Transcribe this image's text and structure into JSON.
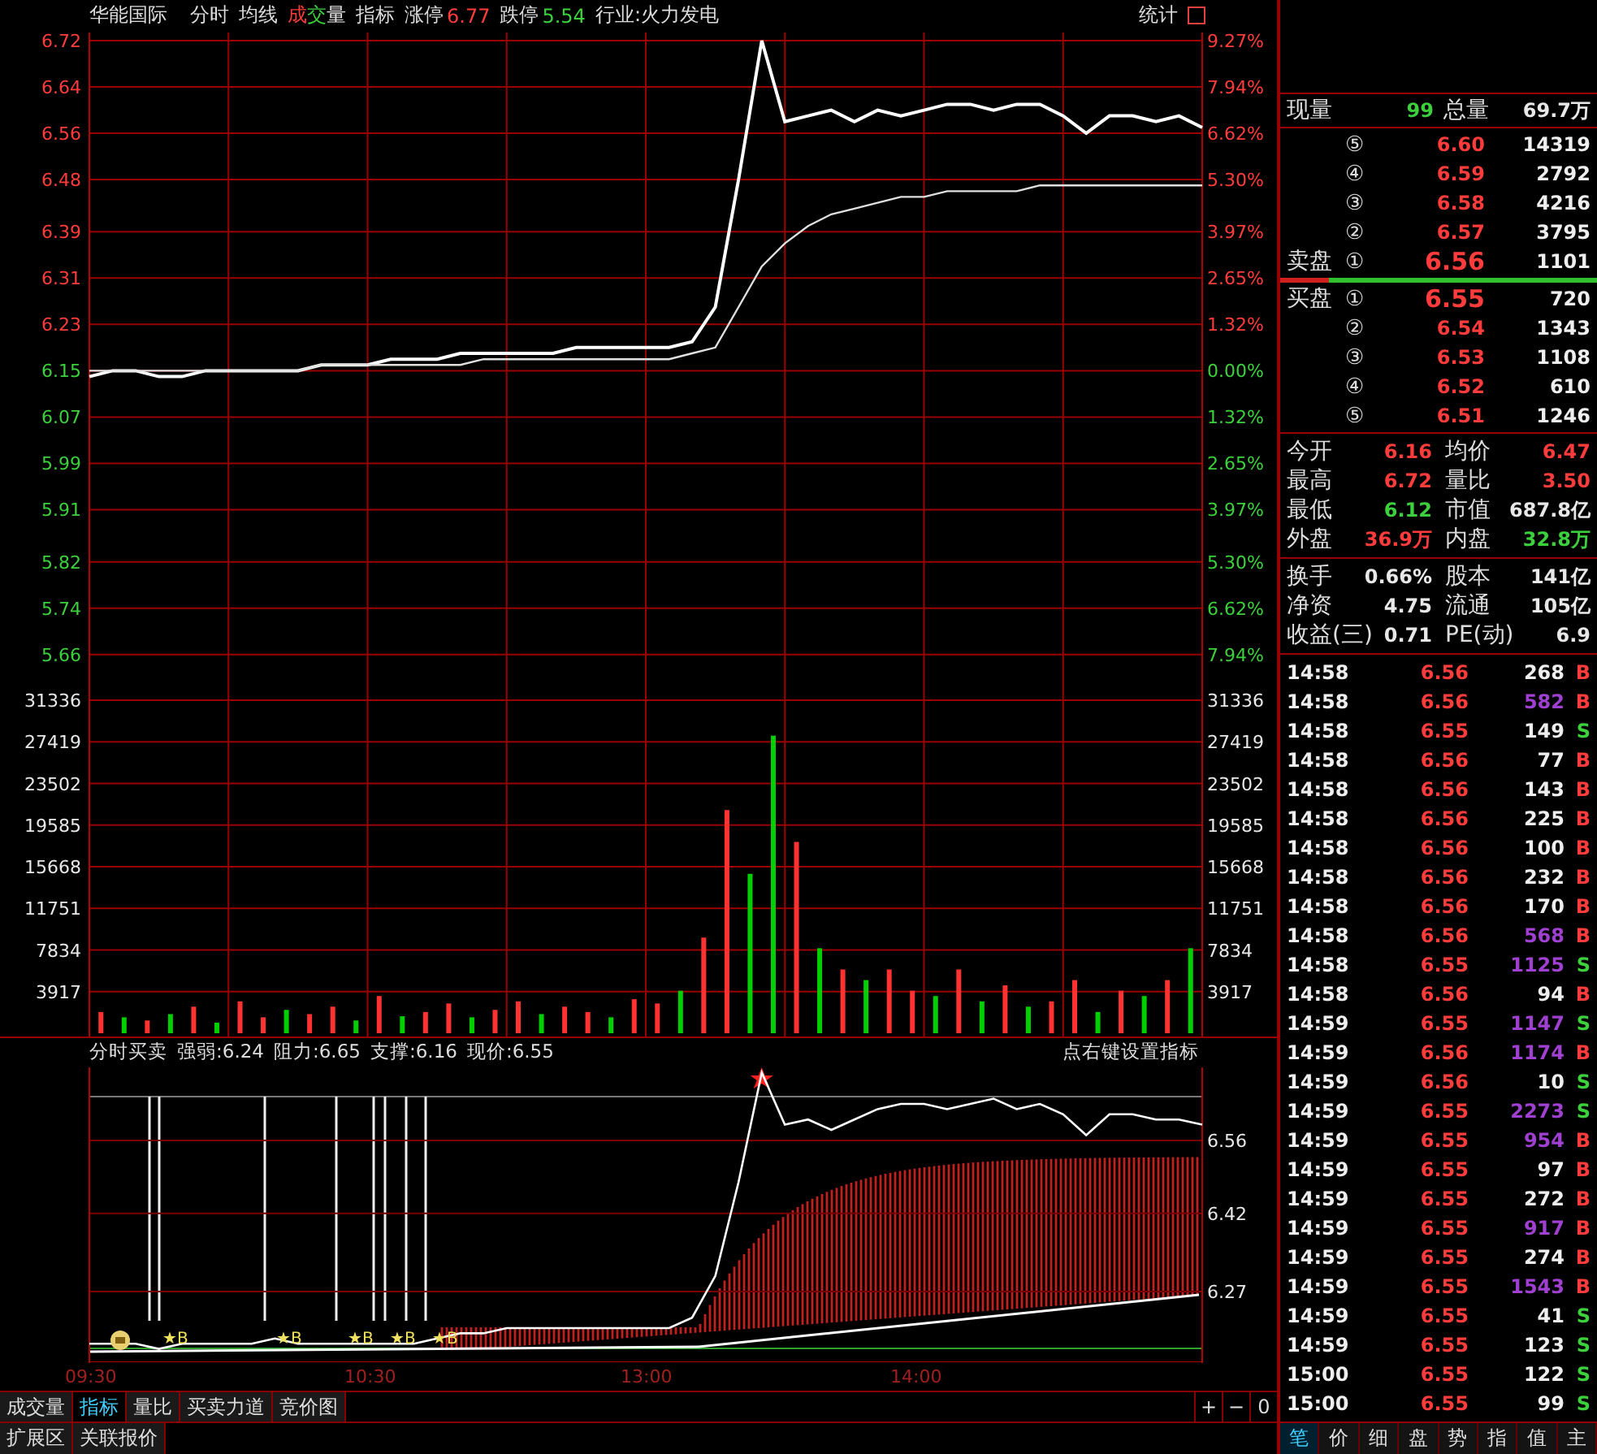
{
  "top_bar": {
    "stock": "华能国际",
    "items": [
      "分时",
      "均线"
    ],
    "volume_legend": "成交量",
    "indicator": "指标",
    "limit_up": {
      "label": "涨停",
      "value": "6.77"
    },
    "limit_down": {
      "label": "跌停",
      "value": "5.54"
    },
    "industry": "行业:火力发电",
    "stats_button": "统计"
  },
  "price_chart": {
    "right_labels": [
      "9.27%",
      "7.94%",
      "6.62%",
      "5.30%",
      "3.97%",
      "2.65%",
      "1.32%",
      "0.00%",
      "1.32%",
      "2.65%",
      "3.97%",
      "5.30%",
      "6.62%",
      "7.94%"
    ],
    "chart_data": {
      "type": "line",
      "grid": true,
      "ylim": [
        5.64,
        6.734
      ],
      "yticks": [
        {
          "value": 6.72,
          "label": "6.72"
        },
        {
          "value": 6.64,
          "label": "6.64"
        },
        {
          "value": 6.56,
          "label": "6.56"
        },
        {
          "value": 6.48,
          "label": "6.48"
        },
        {
          "value": 6.39,
          "label": "6.39"
        },
        {
          "value": 6.31,
          "label": "6.31"
        },
        {
          "value": 6.23,
          "label": "6.23"
        },
        {
          "value": 6.15,
          "label": "6.15"
        },
        {
          "value": 6.07,
          "label": "6.07"
        },
        {
          "value": 5.99,
          "label": "5.99"
        },
        {
          "value": 5.91,
          "label": "5.91"
        },
        {
          "value": 5.82,
          "label": "5.82"
        },
        {
          "value": 5.74,
          "label": "5.74"
        },
        {
          "value": 5.66,
          "label": "5.66"
        }
      ],
      "categories": [
        null,
        null,
        null,
        null,
        null,
        null,
        null,
        null,
        null,
        null,
        null,
        null,
        null,
        null,
        null,
        null,
        null,
        null,
        null,
        null,
        null,
        null,
        null,
        null,
        null,
        null,
        null,
        null,
        null,
        null,
        null,
        null,
        null,
        null,
        null,
        null,
        null,
        null,
        null,
        null,
        null,
        null,
        null,
        null,
        null,
        null,
        null,
        null,
        null
      ],
      "series": [
        {
          "color": "#ffffff",
          "values": [
            6.14,
            6.15,
            6.15,
            6.14,
            6.14,
            6.15,
            6.15,
            6.15,
            6.15,
            6.15,
            6.16,
            6.16,
            6.16,
            6.17,
            6.17,
            6.17,
            6.18,
            6.18,
            6.18,
            6.18,
            6.18,
            6.19,
            6.19,
            6.19,
            6.19,
            6.19,
            6.2,
            6.26,
            6.48,
            6.72,
            6.58,
            6.59,
            6.6,
            6.58,
            6.6,
            6.59,
            6.6,
            6.61,
            6.61,
            6.6,
            6.61,
            6.61,
            6.59,
            6.56,
            6.59,
            6.59,
            6.58,
            6.59,
            6.57
          ]
        },
        {
          "color": "#e0e0e0",
          "values": [
            6.15,
            6.15,
            6.15,
            6.15,
            6.15,
            6.15,
            6.15,
            6.15,
            6.15,
            6.15,
            6.16,
            6.16,
            6.16,
            6.16,
            6.16,
            6.16,
            6.16,
            6.17,
            6.17,
            6.17,
            6.17,
            6.17,
            6.17,
            6.17,
            6.17,
            6.17,
            6.18,
            6.19,
            6.26,
            6.33,
            6.37,
            6.4,
            6.42,
            6.43,
            6.44,
            6.45,
            6.45,
            6.46,
            6.46,
            6.46,
            6.46,
            6.47,
            6.47,
            6.47,
            6.47,
            6.47,
            6.47,
            6.47,
            6.47
          ]
        }
      ]
    }
  },
  "volume_chart": {
    "chart_data": {
      "type": "bar",
      "stacked": true,
      "grid": true,
      "ylim": [
        0,
        31336
      ],
      "yticks": [
        {
          "value": 31336,
          "label": "31336"
        },
        {
          "value": 27419,
          "label": "27419"
        },
        {
          "value": 23502,
          "label": "23502"
        },
        {
          "value": 19585,
          "label": "19585"
        },
        {
          "value": 15668,
          "label": "15668"
        },
        {
          "value": 11751,
          "label": "11751"
        },
        {
          "value": 7834,
          "label": "7834"
        },
        {
          "value": 3917,
          "label": "3917"
        }
      ],
      "categories": [
        null,
        null,
        null,
        null,
        null,
        null,
        null,
        null,
        null,
        null,
        null,
        null,
        null,
        null,
        null,
        null,
        null,
        null,
        null,
        null,
        null,
        null,
        null,
        null,
        null,
        null,
        null,
        null,
        null,
        null,
        null,
        null,
        null,
        null,
        null,
        null,
        null,
        null,
        null,
        null,
        null,
        null,
        null,
        null,
        null,
        null,
        null,
        null
      ],
      "series": [
        {
          "color": "#ff3232",
          "values": [
            2000,
            null,
            1200,
            null,
            2500,
            null,
            3000,
            1500,
            null,
            1800,
            2500,
            null,
            3500,
            null,
            2000,
            2800,
            null,
            2200,
            3000,
            null,
            2500,
            2000,
            null,
            3200,
            2800,
            null,
            9000,
            21000,
            null,
            null,
            18000,
            null,
            6000,
            null,
            6000,
            4000,
            null,
            6000,
            null,
            4500,
            null,
            3000,
            5000,
            null,
            4000,
            null,
            5000,
            null
          ]
        },
        {
          "color": "#00d000",
          "values": [
            null,
            1500,
            null,
            1800,
            null,
            1000,
            null,
            null,
            2200,
            null,
            null,
            1200,
            null,
            1600,
            null,
            null,
            1500,
            null,
            null,
            1800,
            null,
            null,
            1500,
            null,
            null,
            4000,
            null,
            null,
            15000,
            28000,
            null,
            8000,
            null,
            5000,
            null,
            null,
            3500,
            null,
            3000,
            null,
            2500,
            null,
            null,
            2000,
            null,
            3500,
            null,
            8000
          ]
        }
      ]
    }
  },
  "indicator_panel": {
    "title": "分时买卖",
    "readings": [
      "强弱:6.24",
      "阻力:6.65",
      "支撑:6.16",
      "现价:6.55"
    ],
    "hint": "点右键设置指标",
    "signals": [
      {
        "label": "★B"
      },
      {
        "label": "★B"
      },
      {
        "label": "★B"
      },
      {
        "label": "★B"
      },
      {
        "label": "★B"
      }
    ],
    "chart_data": {
      "type": "line",
      "grid": true,
      "ylim": [
        6.133,
        6.7
      ],
      "yticks": [
        {
          "value": 6.56,
          "label": "6.56"
        },
        {
          "value": 6.42,
          "label": "6.42"
        },
        {
          "value": 6.27,
          "label": "6.27"
        }
      ],
      "categories": [
        null,
        null,
        null,
        null,
        null,
        null,
        null,
        null,
        null,
        null,
        null,
        null,
        null,
        null,
        null,
        null,
        null,
        null,
        null,
        null,
        null,
        null,
        null,
        null,
        null,
        null,
        null,
        null,
        null,
        null,
        null,
        null,
        null,
        null,
        null,
        null,
        null,
        null,
        null,
        null,
        null,
        null,
        null,
        null,
        null,
        null,
        null,
        null,
        null
      ],
      "series": [
        {
          "color": "#ffffff",
          "values": [
            6.17,
            6.17,
            6.17,
            6.16,
            6.17,
            6.17,
            6.17,
            6.17,
            6.18,
            6.17,
            6.17,
            6.17,
            6.17,
            6.17,
            6.17,
            6.18,
            6.19,
            6.19,
            6.2,
            6.2,
            6.2,
            6.2,
            6.2,
            6.2,
            6.2,
            6.2,
            6.22,
            6.3,
            6.48,
            6.69,
            6.59,
            6.6,
            6.58,
            6.6,
            6.62,
            6.63,
            6.63,
            6.62,
            6.63,
            6.64,
            6.62,
            6.63,
            6.61,
            6.57,
            6.61,
            6.61,
            6.6,
            6.6,
            6.59
          ]
        }
      ]
    }
  },
  "time_axis": [
    "09:30",
    "10:30",
    "13:00",
    "14:00"
  ],
  "chart_tabs": [
    {
      "label": "成交量",
      "selected": false
    },
    {
      "label": "指标",
      "selected": true
    },
    {
      "label": "量比",
      "selected": false
    },
    {
      "label": "买卖力道",
      "selected": false
    },
    {
      "label": "竞价图",
      "selected": false
    }
  ],
  "zoom_buttons": [
    "+",
    "−",
    "0"
  ],
  "bottom_tabs": [
    {
      "label": "扩展区",
      "selected": false
    },
    {
      "label": "关联报价",
      "selected": false
    }
  ],
  "quote": {
    "current_volume_label": "现量",
    "current_volume": "99",
    "total_volume_label": "总量",
    "total_volume": "69.7万"
  },
  "asks": [
    {
      "level": "⑤",
      "price": "6.60",
      "volume": "14319"
    },
    {
      "level": "④",
      "price": "6.59",
      "volume": "2792"
    },
    {
      "level": "③",
      "price": "6.58",
      "volume": "4216"
    },
    {
      "level": "②",
      "price": "6.57",
      "volume": "3795"
    },
    {
      "label": "卖盘",
      "level": "①",
      "price": "6.56",
      "volume": "1101"
    }
  ],
  "bids": [
    {
      "label": "买盘",
      "level": "①",
      "price": "6.55",
      "volume": "720"
    },
    {
      "level": "②",
      "price": "6.54",
      "volume": "1343"
    },
    {
      "level": "③",
      "price": "6.53",
      "volume": "1108"
    },
    {
      "level": "④",
      "price": "6.52",
      "volume": "610"
    },
    {
      "level": "⑤",
      "price": "6.51",
      "volume": "1246"
    }
  ],
  "stats": [
    {
      "label": "今开",
      "value": "6.16",
      "kind": "up"
    },
    {
      "label": "均价",
      "value": "6.47",
      "kind": "up"
    },
    {
      "label": "最高",
      "value": "6.72",
      "kind": "up"
    },
    {
      "label": "量比",
      "value": "3.50",
      "kind": "up"
    },
    {
      "label": "最低",
      "value": "6.12",
      "kind": "down"
    },
    {
      "label": "市值",
      "value": "687.8亿",
      "kind": "flat"
    },
    {
      "label": "外盘",
      "value": "36.9万",
      "kind": "up"
    },
    {
      "label": "内盘",
      "value": "32.8万",
      "kind": "down"
    }
  ],
  "fundamentals": [
    {
      "label": "换手",
      "value": "0.66%"
    },
    {
      "label": "股本",
      "value": "141亿"
    },
    {
      "label": "净资",
      "value": "4.75"
    },
    {
      "label": "流通",
      "value": "105亿"
    },
    {
      "label": "收益(三)",
      "value": "0.71"
    },
    {
      "label": "PE(动)",
      "value": "6.9"
    }
  ],
  "ticks": [
    {
      "time": "14:58",
      "price": "6.56",
      "volume": "268",
      "large": false,
      "side": "B",
      "kind": "buy"
    },
    {
      "time": "14:58",
      "price": "6.56",
      "volume": "582",
      "large": true,
      "side": "B",
      "kind": "buy"
    },
    {
      "time": "14:58",
      "price": "6.55",
      "volume": "149",
      "large": false,
      "side": "S",
      "kind": "sell"
    },
    {
      "time": "14:58",
      "price": "6.56",
      "volume": "77",
      "large": false,
      "side": "B",
      "kind": "buy"
    },
    {
      "time": "14:58",
      "price": "6.56",
      "volume": "143",
      "large": false,
      "side": "B",
      "kind": "buy"
    },
    {
      "time": "14:58",
      "price": "6.56",
      "volume": "225",
      "large": false,
      "side": "B",
      "kind": "buy"
    },
    {
      "time": "14:58",
      "price": "6.56",
      "volume": "100",
      "large": false,
      "side": "B",
      "kind": "buy"
    },
    {
      "time": "14:58",
      "price": "6.56",
      "volume": "232",
      "large": false,
      "side": "B",
      "kind": "buy"
    },
    {
      "time": "14:58",
      "price": "6.56",
      "volume": "170",
      "large": false,
      "side": "B",
      "kind": "buy"
    },
    {
      "time": "14:58",
      "price": "6.56",
      "volume": "568",
      "large": true,
      "side": "B",
      "kind": "buy"
    },
    {
      "time": "14:58",
      "price": "6.55",
      "volume": "1125",
      "large": true,
      "side": "S",
      "kind": "sell"
    },
    {
      "time": "14:58",
      "price": "6.56",
      "volume": "94",
      "large": false,
      "side": "B",
      "kind": "buy"
    },
    {
      "time": "14:59",
      "price": "6.55",
      "volume": "1147",
      "large": true,
      "side": "S",
      "kind": "sell"
    },
    {
      "time": "14:59",
      "price": "6.56",
      "volume": "1174",
      "large": true,
      "side": "B",
      "kind": "buy"
    },
    {
      "time": "14:59",
      "price": "6.56",
      "volume": "10",
      "large": false,
      "side": "S",
      "kind": "sell"
    },
    {
      "time": "14:59",
      "price": "6.55",
      "volume": "2273",
      "large": true,
      "side": "S",
      "kind": "sell"
    },
    {
      "time": "14:59",
      "price": "6.55",
      "volume": "954",
      "large": true,
      "side": "B",
      "kind": "buy"
    },
    {
      "time": "14:59",
      "price": "6.55",
      "volume": "97",
      "large": false,
      "side": "B",
      "kind": "buy"
    },
    {
      "time": "14:59",
      "price": "6.55",
      "volume": "272",
      "large": false,
      "side": "B",
      "kind": "buy"
    },
    {
      "time": "14:59",
      "price": "6.55",
      "volume": "917",
      "large": true,
      "side": "B",
      "kind": "buy"
    },
    {
      "time": "14:59",
      "price": "6.55",
      "volume": "274",
      "large": false,
      "side": "B",
      "kind": "buy"
    },
    {
      "time": "14:59",
      "price": "6.55",
      "volume": "1543",
      "large": true,
      "side": "B",
      "kind": "buy"
    },
    {
      "time": "14:59",
      "price": "6.55",
      "volume": "41",
      "large": false,
      "side": "S",
      "kind": "sell"
    },
    {
      "time": "14:59",
      "price": "6.55",
      "volume": "123",
      "large": false,
      "side": "S",
      "kind": "sell"
    },
    {
      "time": "15:00",
      "price": "6.55",
      "volume": "122",
      "large": false,
      "side": "S",
      "kind": "sell"
    },
    {
      "time": "15:00",
      "price": "6.55",
      "volume": "99",
      "large": false,
      "side": "S",
      "kind": "sell"
    }
  ],
  "panel_tabs": [
    {
      "label": "笔",
      "selected": true
    },
    {
      "label": "价",
      "selected": false
    },
    {
      "label": "细",
      "selected": false
    },
    {
      "label": "盘",
      "selected": false
    },
    {
      "label": "势",
      "selected": false
    },
    {
      "label": "指",
      "selected": false
    },
    {
      "label": "值",
      "selected": false
    },
    {
      "label": "主",
      "selected": false
    }
  ]
}
